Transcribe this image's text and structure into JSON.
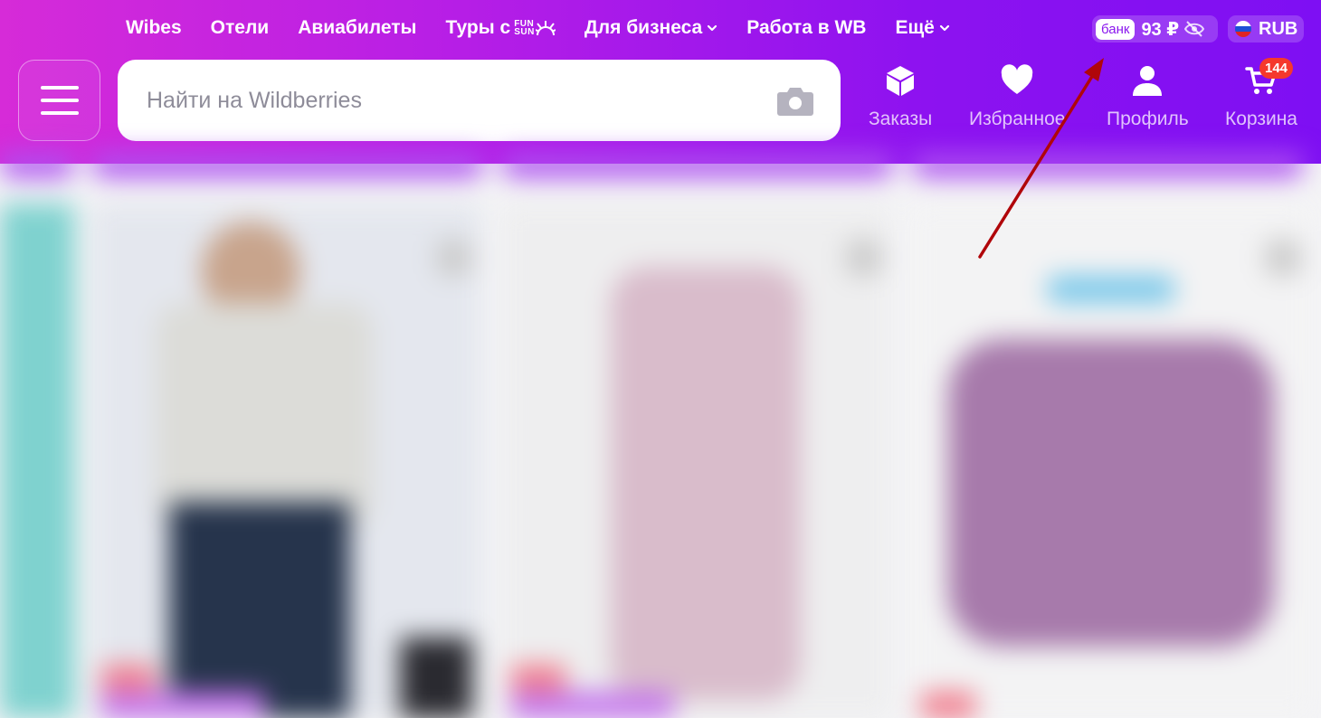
{
  "topnav": {
    "items": [
      {
        "label": "Wibes"
      },
      {
        "label": "Отели"
      },
      {
        "label": "Авиабилеты"
      },
      {
        "label": "Туры с",
        "logo_top": "FUN",
        "logo_bottom": "SUN"
      },
      {
        "label": "Для бизнеса",
        "dropdown": true
      },
      {
        "label": "Работа в WB"
      },
      {
        "label": "Ещё",
        "dropdown": true
      }
    ]
  },
  "bank": {
    "tag": "банк",
    "amount": "93 ₽",
    "icon": "eye-off-icon"
  },
  "currency": {
    "label": "RUB",
    "flag": "russia-flag-icon"
  },
  "search": {
    "placeholder": "Найти на Wildberries",
    "value": ""
  },
  "actions": {
    "orders": {
      "label": "Заказы",
      "icon": "box-icon"
    },
    "favorites": {
      "label": "Избранное",
      "icon": "heart-icon"
    },
    "profile": {
      "label": "Профиль",
      "icon": "user-icon"
    },
    "cart": {
      "label": "Корзина",
      "icon": "cart-icon",
      "badge": "144"
    }
  },
  "colors": {
    "header_start": "#d62bd8",
    "header_end": "#7e0ff3",
    "badge": "#f5382c",
    "arrow": "#b0060a"
  }
}
